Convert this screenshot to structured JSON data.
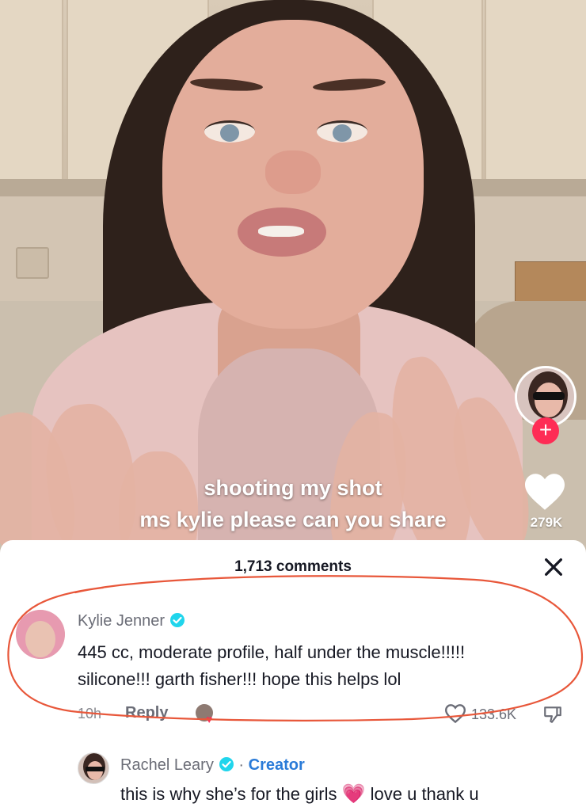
{
  "video": {
    "caption_line1": "shooting my shot",
    "caption_line2": "ms kylie please can you share",
    "like_count": "279K",
    "follow_symbol": "+"
  },
  "comments": {
    "count_label": "1,713 comments",
    "close_symbol": "✕",
    "items": [
      {
        "username": "Kylie Jenner",
        "verified": true,
        "text_line1": "445 cc, moderate profile, half under the muscle!!!!!",
        "text_line2": "silicone!!! garth fisher!!! hope this helps lol",
        "time": "10h",
        "reply_label": "Reply",
        "likes": "133.6K"
      },
      {
        "username": "Rachel Leary",
        "verified": true,
        "separator": "·",
        "tag": "Creator",
        "text_before_emoji": "this is why she’s for the girls",
        "emoji": "💗",
        "text_after_emoji": "love u thank u"
      }
    ]
  },
  "colors": {
    "accent": "#fe2c55",
    "creator_tag": "#2a7bd8",
    "annotation": "#e8573a"
  }
}
